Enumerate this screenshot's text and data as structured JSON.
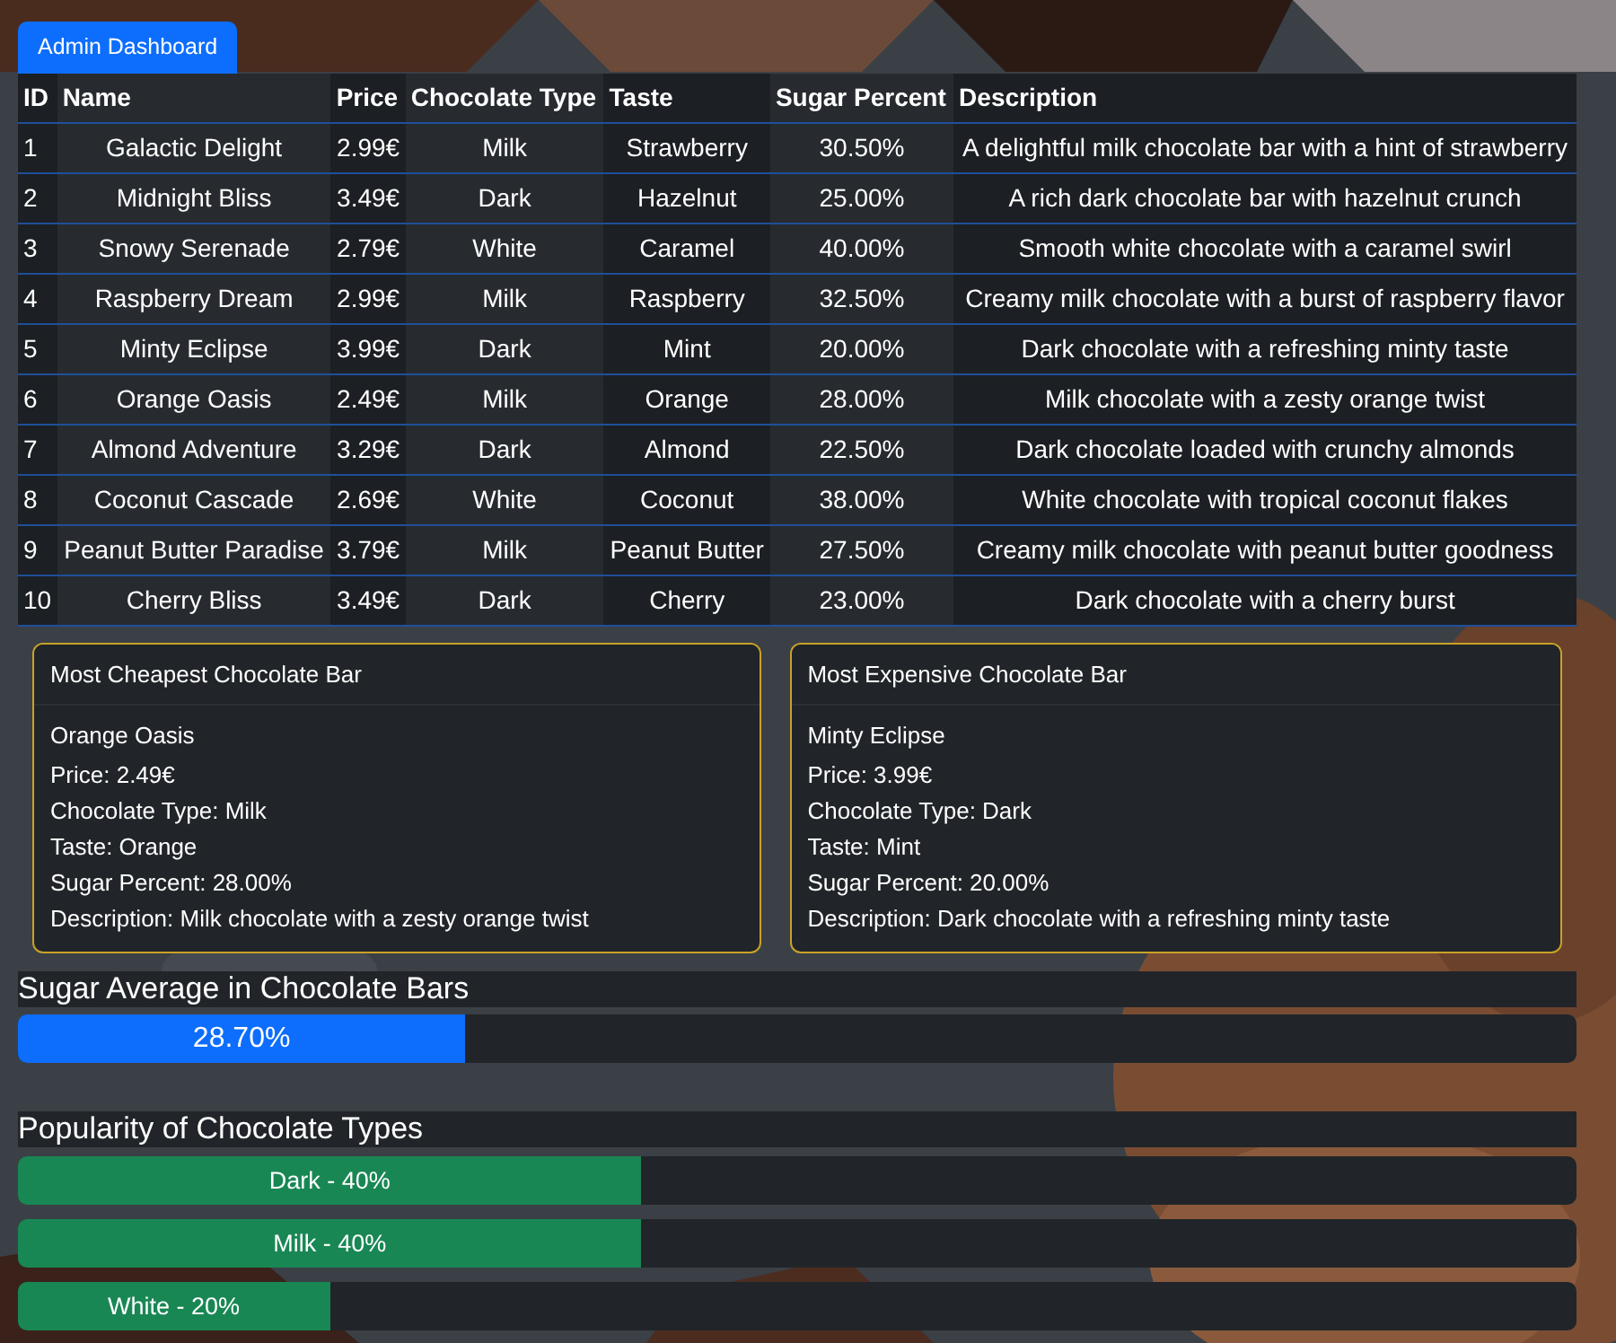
{
  "header_button": "Admin Dashboard",
  "table": {
    "columns": [
      "ID",
      "Name",
      "Price",
      "Chocolate Type",
      "Taste",
      "Sugar Percent",
      "Description"
    ],
    "rows": [
      [
        "1",
        "Galactic Delight",
        "2.99€",
        "Milk",
        "Strawberry",
        "30.50%",
        "A delightful milk chocolate bar with a hint of strawberry"
      ],
      [
        "2",
        "Midnight Bliss",
        "3.49€",
        "Dark",
        "Hazelnut",
        "25.00%",
        "A rich dark chocolate bar with hazelnut crunch"
      ],
      [
        "3",
        "Snowy Serenade",
        "2.79€",
        "White",
        "Caramel",
        "40.00%",
        "Smooth white chocolate with a caramel swirl"
      ],
      [
        "4",
        "Raspberry Dream",
        "2.99€",
        "Milk",
        "Raspberry",
        "32.50%",
        "Creamy milk chocolate with a burst of raspberry flavor"
      ],
      [
        "5",
        "Minty Eclipse",
        "3.99€",
        "Dark",
        "Mint",
        "20.00%",
        "Dark chocolate with a refreshing minty taste"
      ],
      [
        "6",
        "Orange Oasis",
        "2.49€",
        "Milk",
        "Orange",
        "28.00%",
        "Milk chocolate with a zesty orange twist"
      ],
      [
        "7",
        "Almond Adventure",
        "3.29€",
        "Dark",
        "Almond",
        "22.50%",
        "Dark chocolate loaded with crunchy almonds"
      ],
      [
        "8",
        "Coconut Cascade",
        "2.69€",
        "White",
        "Coconut",
        "38.00%",
        "White chocolate with tropical coconut flakes"
      ],
      [
        "9",
        "Peanut Butter Paradise",
        "3.79€",
        "Milk",
        "Peanut Butter",
        "27.50%",
        "Creamy milk chocolate with peanut butter goodness"
      ],
      [
        "10",
        "Cherry Bliss",
        "3.49€",
        "Dark",
        "Cherry",
        "23.00%",
        "Dark chocolate with a cherry burst"
      ]
    ]
  },
  "cards": [
    {
      "title": "Most Cheapest Chocolate Bar",
      "name": "Orange Oasis",
      "lines": [
        "Price: 2.49€",
        "Chocolate Type: Milk",
        "Taste: Orange",
        "Sugar Percent: 28.00%",
        "Description: Milk chocolate with a zesty orange twist"
      ]
    },
    {
      "title": "Most Expensive Chocolate Bar",
      "name": "Minty Eclipse",
      "lines": [
        "Price: 3.99€",
        "Chocolate Type: Dark",
        "Taste: Mint",
        "Sugar Percent: 20.00%",
        "Description: Dark chocolate with a refreshing minty taste"
      ]
    }
  ],
  "sugar_average": {
    "title": "Sugar Average in Chocolate Bars",
    "level": 0.287,
    "reading": "28.70%"
  },
  "popularity": {
    "title": "Popularity of Chocolate Types",
    "bars": [
      {
        "label": "Dark - 40%",
        "level": 0.4
      },
      {
        "label": "Milk - 40%",
        "level": 0.4
      },
      {
        "label": "White - 20%",
        "level": 0.2
      }
    ]
  }
}
